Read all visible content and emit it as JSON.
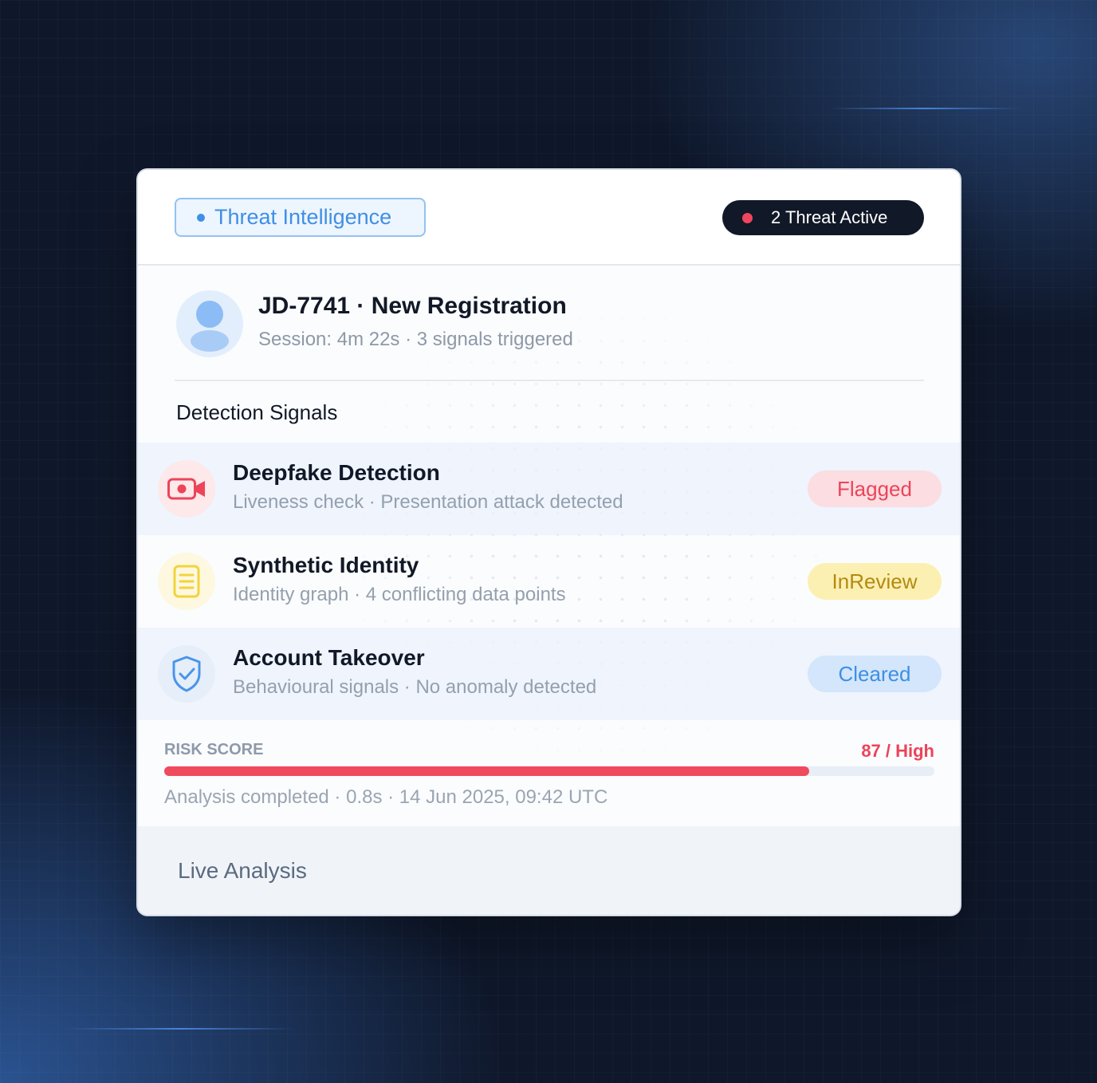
{
  "header": {
    "chip_label": "Threat Intelligence",
    "active_label": "2 Threat Active"
  },
  "user": {
    "title": "JD-7741 · New Registration",
    "subtitle": "Session: 4m 22s · 3 signals triggered"
  },
  "signals_section": {
    "title": "Detection Signals",
    "items": [
      {
        "title": "Deepfake Detection",
        "subtitle": "Liveness check · Presentation attack detected",
        "status": "Flagged",
        "icon": "video-camera-icon",
        "color": "#ec4459"
      },
      {
        "title": "Synthetic Identity",
        "subtitle": "Identity graph · 4 conflicting data points",
        "status": "InReview",
        "icon": "document-icon",
        "color": "#c79a12"
      },
      {
        "title": "Account Takeover",
        "subtitle": "Behavioural signals · No anomaly detected",
        "status": "Cleared",
        "icon": "shield-check-icon",
        "color": "#3f8fe5"
      }
    ]
  },
  "risk": {
    "label": "RISK SCORE",
    "value_text": "87 / High",
    "score_fraction": 0.837,
    "note": "Analysis completed · 0.8s · 14 Jun 2025, 09:42 UTC"
  },
  "footer": {
    "label": "Live Analysis"
  },
  "colors": {
    "accent": "#3f8fe5",
    "danger": "#f04a5e",
    "warning": "#f4d94a",
    "dark": "#111827"
  }
}
